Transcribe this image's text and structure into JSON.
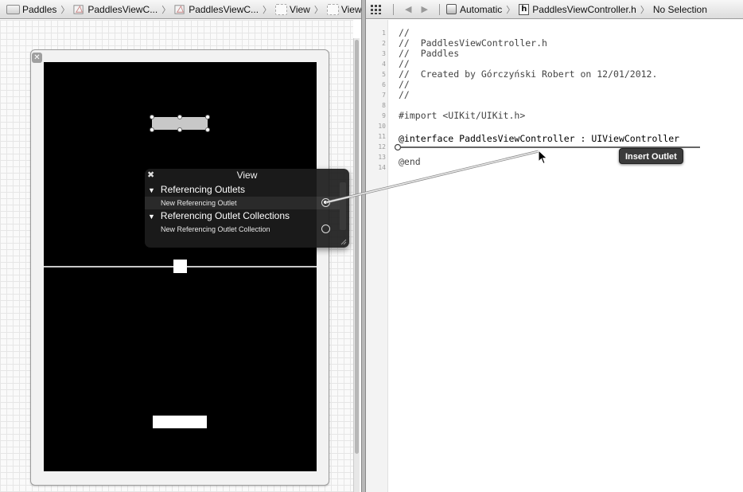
{
  "breadcrumb_left": [
    {
      "label": "Paddles",
      "icon": "folder-icon"
    },
    {
      "label": "PaddlesViewC...",
      "icon": "storyboard-icon"
    },
    {
      "label": "PaddlesViewC...",
      "icon": "storyboard-icon"
    },
    {
      "label": "View",
      "icon": "view-icon"
    },
    {
      "label": "View",
      "icon": "view-icon"
    }
  ],
  "breadcrumb_right": {
    "mode": "Automatic",
    "file": "PaddlesViewController.h",
    "selection": "No Selection"
  },
  "scene_close": "✕",
  "hud": {
    "close": "✖",
    "title": "View",
    "section1": "Referencing Outlets",
    "row1": "New Referencing Outlet",
    "section2": "Referencing Outlet Collections",
    "row2": "New Referencing Outlet Collection",
    "triangle": "▼"
  },
  "code_lines": [
    {
      "n": "1",
      "text": "//"
    },
    {
      "n": "2",
      "text": "//  PaddlesViewController.h"
    },
    {
      "n": "3",
      "text": "//  Paddles"
    },
    {
      "n": "4",
      "text": "//"
    },
    {
      "n": "5",
      "text": "//  Created by Górczyński Robert on 12/01/2012."
    },
    {
      "n": "6",
      "text": "//"
    },
    {
      "n": "7",
      "text": "//"
    },
    {
      "n": "8",
      "text": ""
    },
    {
      "n": "9",
      "text": "#import <UIKit/UIKit.h>"
    },
    {
      "n": "10",
      "text": ""
    },
    {
      "n": "11",
      "text": "@interface PaddlesViewController : UIViewController"
    },
    {
      "n": "12",
      "text": ""
    },
    {
      "n": "13",
      "text": "@end"
    },
    {
      "n": "14",
      "text": ""
    }
  ],
  "tooltip": "Insert Outlet",
  "colors": {
    "view_bg": "#000000",
    "hud_bg": "#1c1c1c",
    "paddle": "#ffffff"
  }
}
